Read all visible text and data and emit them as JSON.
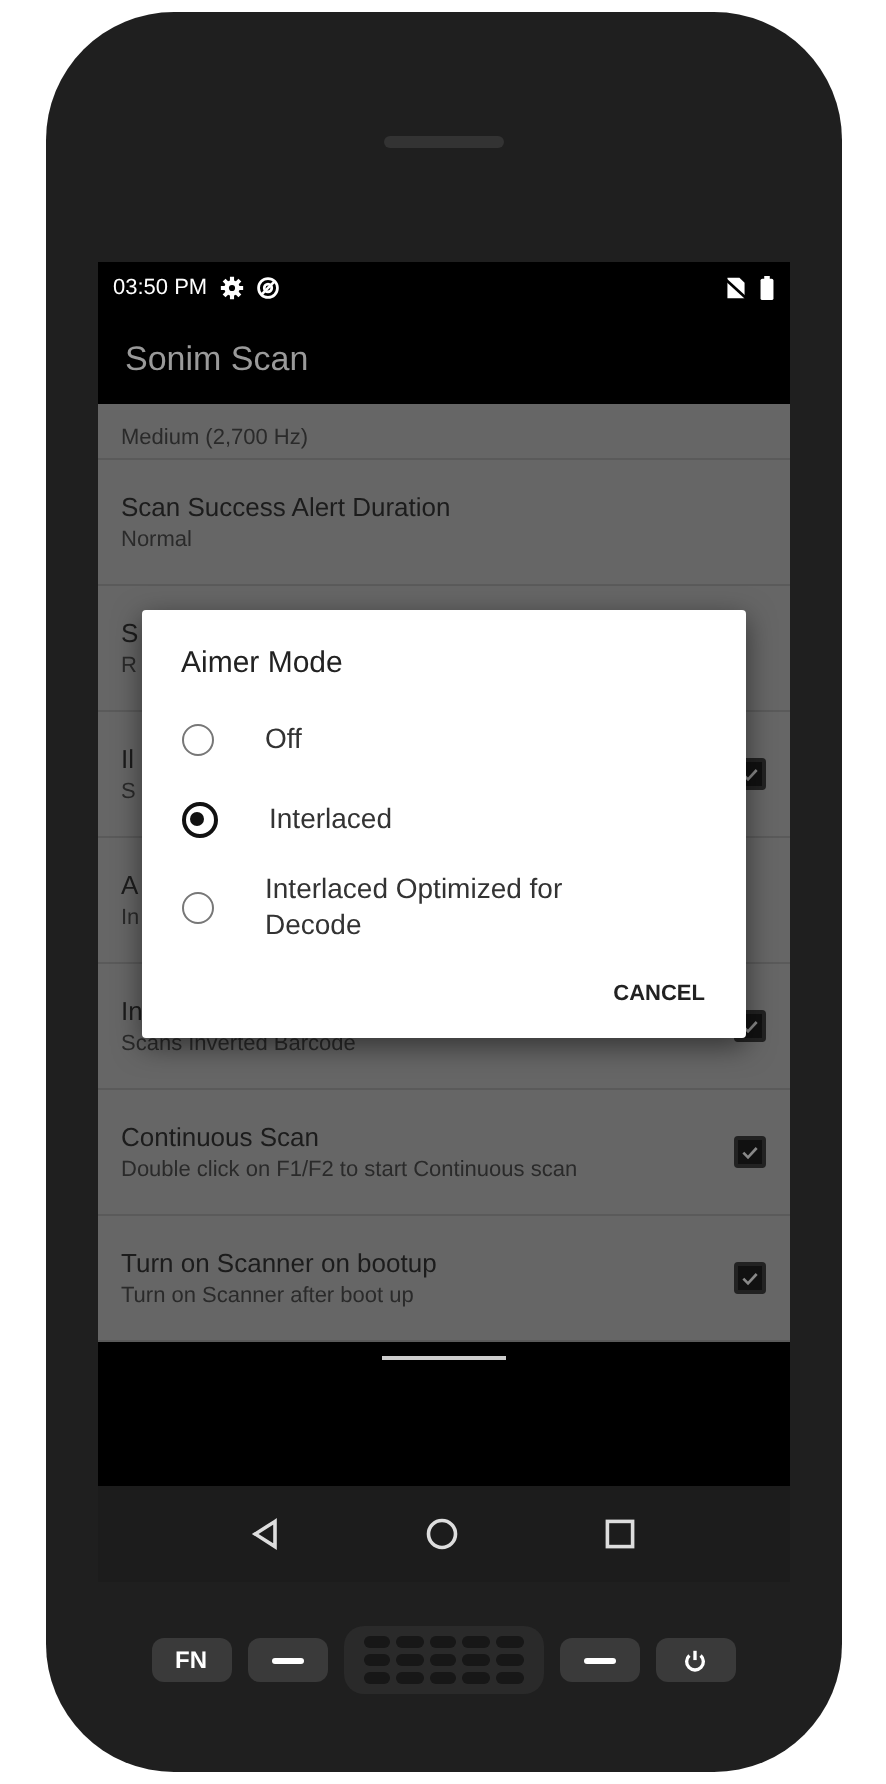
{
  "status_bar": {
    "time": "03:50 PM"
  },
  "app_bar": {
    "title": "Sonim Scan"
  },
  "settings": [
    {
      "kind": "text",
      "subtitle": "Medium (2,700 Hz)"
    },
    {
      "kind": "text",
      "title": "Scan Success Alert Duration",
      "subtitle": "Normal"
    },
    {
      "kind": "text",
      "title": "S",
      "subtitle": "R"
    },
    {
      "kind": "checkbox",
      "title": "Il",
      "subtitle": "S",
      "checked": true
    },
    {
      "kind": "text",
      "title": "A",
      "subtitle": "In"
    },
    {
      "kind": "checkbox",
      "title": "In",
      "subtitle": "Scans Inverted Barcode",
      "checked": true
    },
    {
      "kind": "checkbox",
      "title": "Continuous Scan",
      "subtitle": "Double click on F1/F2 to start Continuous scan",
      "checked": true
    },
    {
      "kind": "checkbox",
      "title": "Turn on Scanner on bootup",
      "subtitle": "Turn on Scanner after boot up",
      "checked": true
    }
  ],
  "dialog": {
    "title": "Aimer Mode",
    "options": [
      {
        "label": "Off",
        "selected": false
      },
      {
        "label": "Interlaced",
        "selected": true
      },
      {
        "label": "Interlaced Optimized for Decode",
        "selected": false
      }
    ],
    "buttons": [
      "CANCEL"
    ]
  },
  "hardware_keys": [
    {
      "kind": "fn",
      "label": "FN"
    },
    {
      "kind": "dash"
    },
    {
      "kind": "grille"
    },
    {
      "kind": "dash"
    },
    {
      "kind": "power"
    }
  ]
}
